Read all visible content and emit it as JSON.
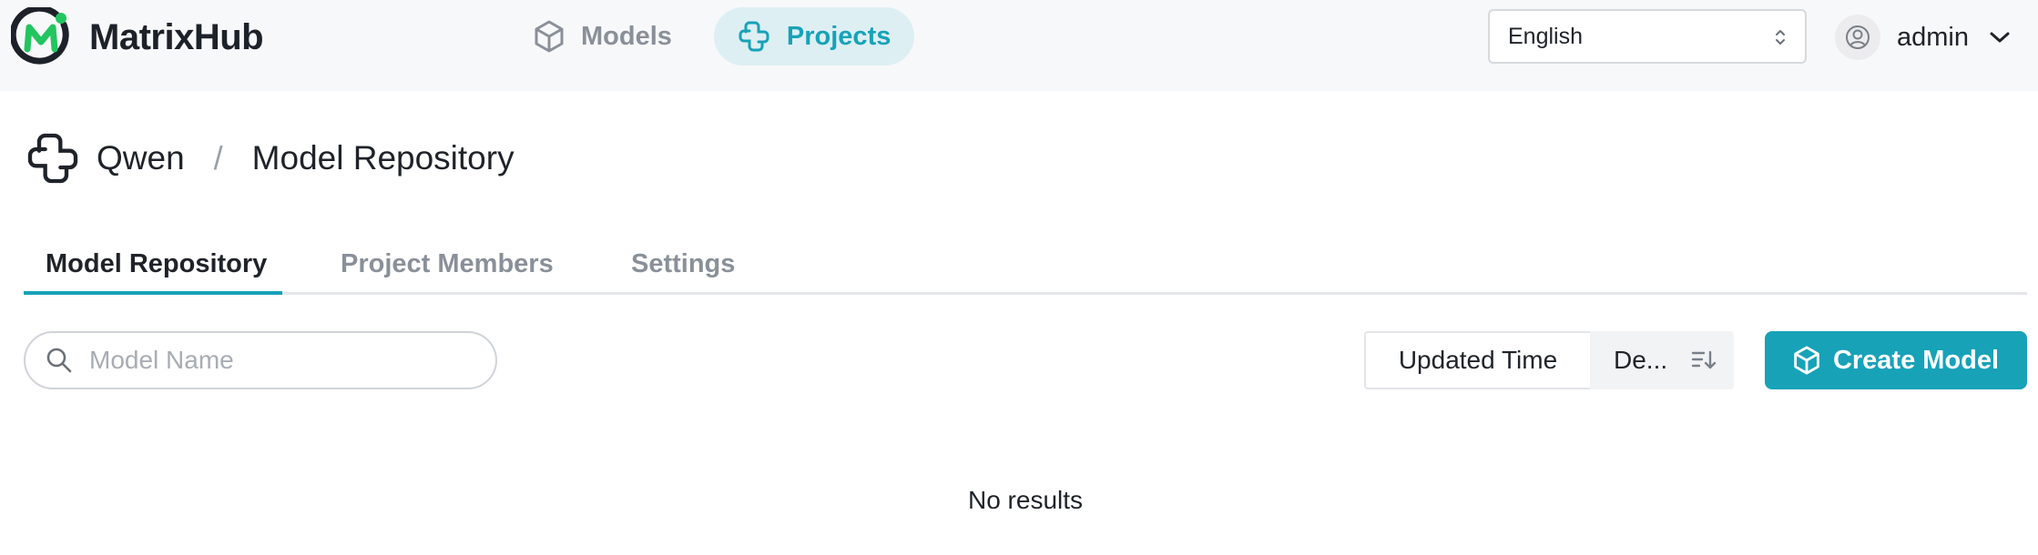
{
  "app": {
    "name": "MatrixHub",
    "logo_icon": "matrixhub-logo-icon",
    "accent_color": "#17a2b8"
  },
  "nav": {
    "items": [
      {
        "label": "Models",
        "icon": "cube-icon",
        "active": false
      },
      {
        "label": "Projects",
        "icon": "project-icon",
        "active": true
      }
    ]
  },
  "language": {
    "selected": "English",
    "icon": "select-arrows-icon"
  },
  "user": {
    "name": "admin",
    "avatar_icon": "user-avatar-icon",
    "menu_icon": "chevron-down-icon"
  },
  "breadcrumb": {
    "project": "Qwen",
    "separator": "/",
    "page": "Model Repository"
  },
  "tabs": [
    {
      "label": "Model Repository",
      "active": true
    },
    {
      "label": "Project Members",
      "active": false
    },
    {
      "label": "Settings",
      "active": false
    }
  ],
  "toolbar": {
    "search_placeholder": "Model Name",
    "search_value": "",
    "sort_field": "Updated Time",
    "sort_order": "De...",
    "sort_icon": "sort-descending-icon",
    "create_label": "Create Model",
    "create_icon": "cube-icon"
  },
  "content": {
    "empty_message": "No results"
  }
}
